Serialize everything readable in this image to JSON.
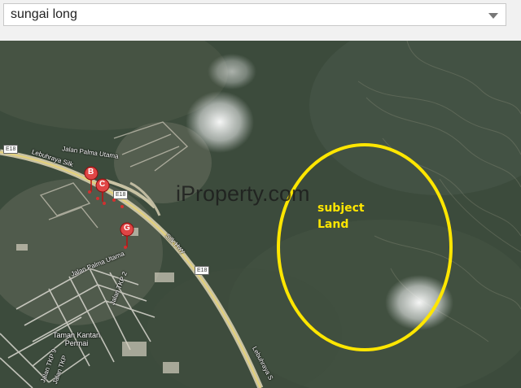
{
  "search": {
    "value": "sungai long"
  },
  "watermark": "iProperty.com",
  "annotation": {
    "line1": "subject",
    "line2": "Land",
    "color": "#ffe600"
  },
  "markers": [
    {
      "label": "B",
      "name": "marker-b"
    },
    {
      "label": "C",
      "name": "marker-c"
    },
    {
      "label": "G",
      "name": "marker-g"
    }
  ],
  "road_shields": [
    "E18",
    "E18",
    "E18"
  ],
  "map_labels": {
    "jalan_palma_utama_top": "Jalan Palma Utama",
    "lebuhraya_silk": "Lebuhraya Silk",
    "silk_hwy": "Silk Hwy",
    "jalan_palma_utama_bottom": "Jalan Palma Utama",
    "jalan_tkp_2": "Jalan TKP 2",
    "taman_kantan_permai": "Taman Kantan\nPermai",
    "jalan_tkp_9": "Jalan TKP 9",
    "jalan_tkp_10": "Jalan TKP",
    "lebuhraya_bottom": "Lebuhraya S"
  }
}
